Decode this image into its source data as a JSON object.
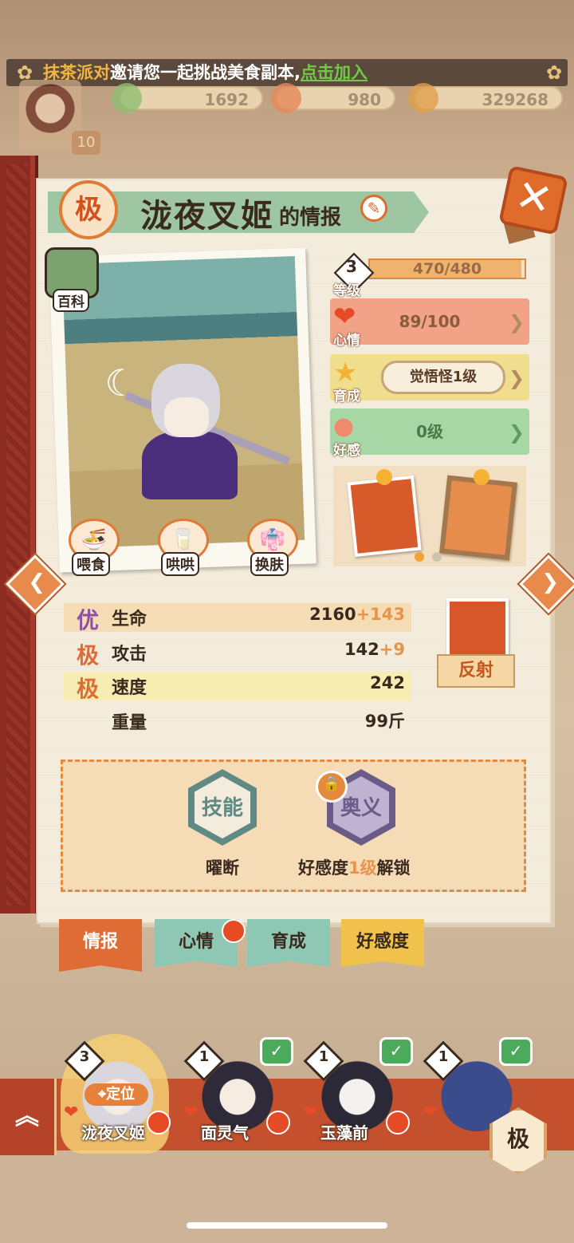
{
  "banner": {
    "team": "抹茶派对",
    "message": "邀请您一起挑战美食副本,",
    "join": "点击加入"
  },
  "resources": [
    {
      "icon": "leaf-coin-icon",
      "value": "1692"
    },
    {
      "icon": "candy-icon",
      "value": "980"
    },
    {
      "icon": "coin-icon",
      "value": "329268"
    }
  ],
  "top_avatar_level": "10",
  "title": {
    "rank": "极",
    "name": "泷夜叉姬",
    "suffix": "的情报"
  },
  "baike_label": "百科",
  "actions": [
    {
      "label": "喂食",
      "icon": "noodle-bowl-icon"
    },
    {
      "label": "哄哄",
      "icon": "milk-carton-icon"
    },
    {
      "label": "换肤",
      "icon": "kimono-icon"
    }
  ],
  "stats": {
    "level": {
      "num": "3",
      "label": "等级",
      "progress": "470/480",
      "fraction": 0.979
    },
    "mood": {
      "label": "心情",
      "value": "89/100"
    },
    "growth": {
      "label": "育成",
      "value": "觉悟怪1级"
    },
    "affection": {
      "label": "好感",
      "value": "0级"
    }
  },
  "attributes": [
    {
      "grade": "优",
      "name": "生命",
      "base": "2160",
      "bonus": "+143"
    },
    {
      "grade": "极",
      "name": "攻击",
      "base": "142",
      "bonus": "+9"
    },
    {
      "grade": "极",
      "name": "速度",
      "base": "242",
      "bonus": ""
    },
    {
      "grade": "",
      "name": "重量",
      "base": "99斤",
      "bonus": ""
    }
  ],
  "trait": {
    "label": "反射",
    "icon": "reflect-icon"
  },
  "skills": {
    "skill": {
      "hex_label": "技能",
      "name": "曜断"
    },
    "secret": {
      "hex_label": "奥义",
      "unlock_prefix": "好感度",
      "unlock_level": "1级",
      "unlock_suffix": "解锁"
    }
  },
  "tabs": [
    "情报",
    "心情",
    "育成",
    "好感度"
  ],
  "heroes": [
    {
      "level": "3",
      "name": "泷夜叉姬",
      "locate": "定位"
    },
    {
      "level": "1",
      "name": "面灵气"
    },
    {
      "level": "1",
      "name": "玉藻前"
    },
    {
      "level": "1",
      "name": ""
    }
  ],
  "filter_button": "极",
  "colors": {
    "accent_orange": "#e06c35",
    "bonus_orange": "#e8944a",
    "green": "#73c74a"
  }
}
